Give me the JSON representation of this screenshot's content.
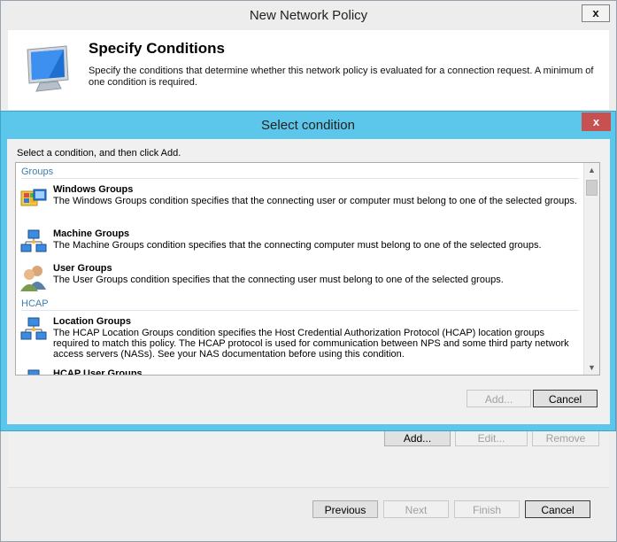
{
  "outer": {
    "title": "New Network Policy",
    "close": "x",
    "header_title": "Specify Conditions",
    "header_desc": "Specify the conditions that determine whether this network policy is evaluated for a connection request. A minimum of one condition is required.",
    "content_buttons": {
      "add": "Add...",
      "edit": "Edit...",
      "remove": "Remove"
    },
    "footer_buttons": {
      "previous": "Previous",
      "next": "Next",
      "finish": "Finish",
      "cancel": "Cancel"
    }
  },
  "dialog": {
    "title": "Select condition",
    "close": "x",
    "prompt": "Select a condition, and then click Add.",
    "groups": [
      {
        "name": "Groups",
        "items": [
          {
            "name": "Windows Groups",
            "desc": "The Windows Groups condition specifies that the connecting user or computer must belong to one of the selected groups.",
            "icon": "windows-groups-icon"
          },
          {
            "name": "Machine Groups",
            "desc": "The Machine Groups condition specifies that the connecting computer must belong to one of the selected groups.",
            "icon": "machine-groups-icon"
          },
          {
            "name": "User Groups",
            "desc": "The User Groups condition specifies that the connecting user must belong to one of the selected groups.",
            "icon": "user-groups-icon"
          }
        ]
      },
      {
        "name": "HCAP",
        "items": [
          {
            "name": "Location Groups",
            "desc": "The HCAP Location Groups condition specifies the Host Credential Authorization Protocol (HCAP) location groups required to match this policy. The HCAP protocol is used for communication between NPS and some third party network access servers (NASs). See your NAS documentation before using this condition.",
            "icon": "location-groups-icon"
          },
          {
            "name": "HCAP User Groups",
            "desc": "",
            "icon": "hcap-user-groups-icon"
          }
        ]
      }
    ],
    "buttons": {
      "add": "Add...",
      "cancel": "Cancel"
    }
  },
  "colors": {
    "dialog_frame": "#5cc7ea",
    "close_red": "#c75050",
    "group_header": "#3c7fb1"
  }
}
